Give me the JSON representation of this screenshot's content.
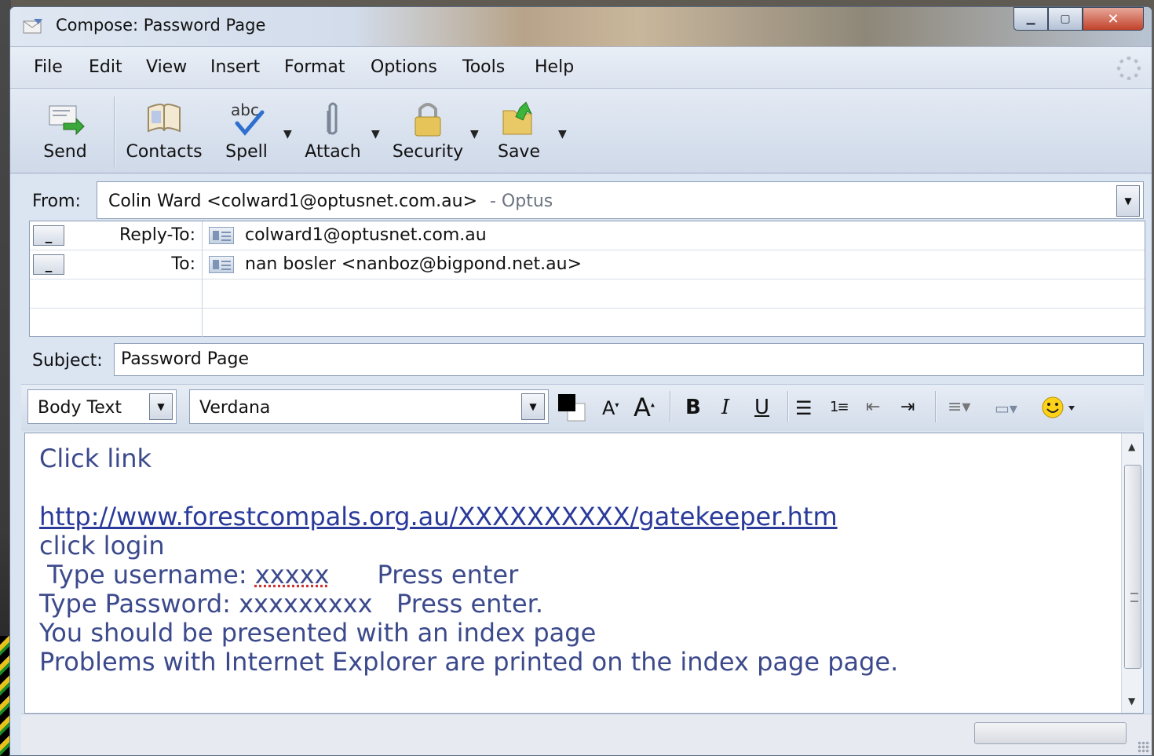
{
  "window": {
    "title": "Compose: Password Page"
  },
  "menu": [
    "File",
    "Edit",
    "View",
    "Insert",
    "Format",
    "Options",
    "Tools",
    "Help"
  ],
  "toolbar": {
    "send": "Send",
    "contacts": "Contacts",
    "spell": "Spell",
    "attach": "Attach",
    "security": "Security",
    "save": "Save"
  },
  "from": {
    "label": "From:",
    "value": "Colin Ward <colward1@optusnet.com.au>",
    "account": "- Optus"
  },
  "recipients": [
    {
      "type": "Reply-To:",
      "address": "colward1@optusnet.com.au"
    },
    {
      "type": "To:",
      "address": "nan bosler <nanboz@bigpond.net.au>"
    }
  ],
  "subject": {
    "label": "Subject:",
    "value": "Password Page"
  },
  "format": {
    "paragraph_style": "Body Text",
    "font": "Verdana",
    "text_color": "#000000"
  },
  "body": {
    "line1": "Click link",
    "link": "http://www.forestcompals.org.au/XXXXXXXXXX/gatekeeper.htm",
    "line3": "click login",
    "line4_a": " Type username: ",
    "line4_user": "xxxxx",
    "line4_b": "      Press enter",
    "line5": "Type Password: xxxxxxxxx   Press enter.",
    "line6": "You should be presented with an index page",
    "line7": "Problems with Internet Explorer are printed on the index page page."
  }
}
